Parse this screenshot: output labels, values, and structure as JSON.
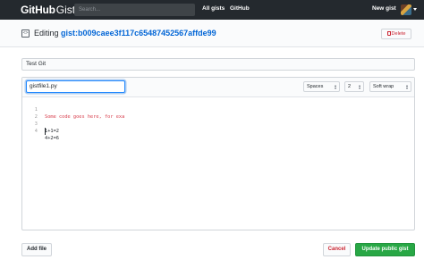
{
  "header": {
    "brand_github": "GitHub",
    "brand_gist": "Gist",
    "search_placeholder": "Search...",
    "nav": {
      "all_gists": "All gists",
      "github": "GitHub",
      "new_gist": "New gist"
    }
  },
  "pagehead": {
    "editing_label": "Editing",
    "gist_id": "gist:b009caee3f117c65487452567affde99",
    "delete_label": "Delete"
  },
  "description": {
    "value": "Test Git"
  },
  "file": {
    "filename": "gistfile1.py",
    "indent_mode": "Spaces",
    "indent_size": "2",
    "wrap_mode": "Soft wrap",
    "lines": [
      {
        "num": "1",
        "text": "Some code goes here, for exa"
      },
      {
        "num": "2",
        "text": ""
      },
      {
        "num": "3",
        "text": "1+1=2"
      },
      {
        "num": "4",
        "text": "4+2=6"
      }
    ]
  },
  "actions": {
    "add_file": "Add file",
    "cancel": "Cancel",
    "update": "Update public gist"
  },
  "colors": {
    "header_bg": "#24292e",
    "link_blue": "#0366d6",
    "danger_red": "#cb2431",
    "primary_green": "#28a745"
  }
}
